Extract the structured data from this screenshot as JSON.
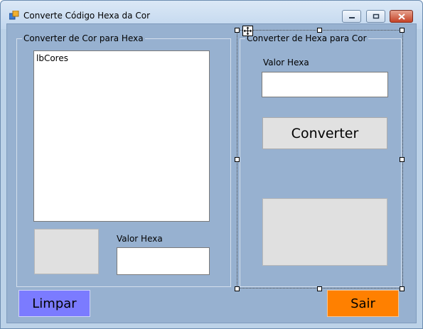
{
  "window": {
    "title": "Converte Código Hexa da Cor"
  },
  "colors": {
    "form_background": "#97b1d0",
    "limpar_button": "#7b7bff",
    "sair_button": "#ff8000",
    "swatch": "#e0e0e0"
  },
  "left_group": {
    "title": "Converter de Cor para Hexa",
    "listbox_text": "lbCores",
    "hex_label": "Valor Hexa",
    "hex_value": ""
  },
  "right_group": {
    "title": "Converter de Hexa  para Cor",
    "hex_label": "Valor Hexa",
    "hex_value": "",
    "convert_label": "Converter"
  },
  "footer": {
    "limpar_label": "Limpar",
    "sair_label": "Sair"
  },
  "icons": {
    "app": "app-icon",
    "minimize": "minimize-icon",
    "maximize": "maximize-icon",
    "close": "close-icon",
    "move": "move-icon"
  }
}
